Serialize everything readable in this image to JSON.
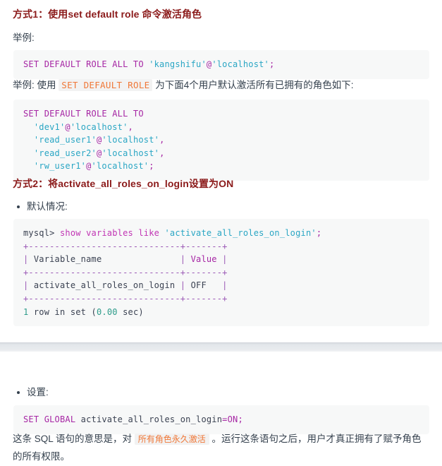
{
  "document": {
    "language": "zh-CN",
    "theme": {
      "heading_color": "#8b1a1a",
      "body_color": "#34404d",
      "code_bg": "#f7f8f8",
      "inline_code_color": "#f07838",
      "inline_code_bg": "#f2f2f2",
      "keyword_color": "#a626a4",
      "string_color": "#2aa6c4",
      "number_color": "#2d9c8a",
      "band_color": "#e4e7eb"
    }
  },
  "sections": [
    {
      "id": "method-1",
      "heading": {
        "prefix": "方式1：",
        "body": "使用set default role 命令激活角色",
        "full": "方式1：使用set default role 命令激活角色"
      },
      "label_example_1": "举例:",
      "code_block_1": {
        "lines": [
          [
            {
              "t": "SET DEFAULT ROLE ALL TO ",
              "c": "kw"
            },
            {
              "t": "'kangshifu'",
              "c": "str"
            },
            {
              "t": "@",
              "c": "punc"
            },
            {
              "t": "'localhost'",
              "c": "str"
            },
            {
              "t": ";",
              "c": "punc"
            }
          ]
        ]
      },
      "label_example_2": {
        "before": "举例: 使用 ",
        "code": "SET DEFAULT ROLE",
        "after": " 为下面4个用户默认激活所有已拥有的角色如下:"
      },
      "code_block_2": {
        "lines": [
          [
            {
              "t": "SET DEFAULT ROLE ALL TO",
              "c": "kw"
            }
          ],
          [
            {
              "t": "  ",
              "c": "plain"
            },
            {
              "t": "'dev1'",
              "c": "str"
            },
            {
              "t": "@",
              "c": "punc"
            },
            {
              "t": "'localhost'",
              "c": "str"
            },
            {
              "t": ",",
              "c": "punc"
            }
          ],
          [
            {
              "t": "  ",
              "c": "plain"
            },
            {
              "t": "'read_user1'",
              "c": "str"
            },
            {
              "t": "@",
              "c": "punc"
            },
            {
              "t": "'localhost'",
              "c": "str"
            },
            {
              "t": ",",
              "c": "punc"
            }
          ],
          [
            {
              "t": "  ",
              "c": "plain"
            },
            {
              "t": "'read_user2'",
              "c": "str"
            },
            {
              "t": "@",
              "c": "punc"
            },
            {
              "t": "'localhost'",
              "c": "str"
            },
            {
              "t": ",",
              "c": "punc"
            }
          ],
          [
            {
              "t": "  ",
              "c": "plain"
            },
            {
              "t": "'rw_user1'",
              "c": "str"
            },
            {
              "t": "@",
              "c": "punc"
            },
            {
              "t": "'localhost'",
              "c": "str"
            },
            {
              "t": ";",
              "c": "punc"
            }
          ]
        ]
      }
    },
    {
      "id": "method-2",
      "heading": {
        "prefix": "方式2：",
        "body": "将activate_all_roles_on_login设置为ON",
        "full": "方式2：将activate_all_roles_on_login设置为ON"
      },
      "bullet_default": "默认情况:",
      "code_block_mysql": {
        "lines": [
          [
            {
              "t": "mysql> ",
              "c": "prompt"
            },
            {
              "t": "show variables like ",
              "c": "kw2"
            },
            {
              "t": "'activate_all_roles_on_login'",
              "c": "str"
            },
            {
              "t": ";",
              "c": "punc"
            }
          ],
          [
            {
              "t": "+-----------------------------+-------+",
              "c": "sep"
            }
          ],
          [
            {
              "t": "| ",
              "c": "sep"
            },
            {
              "t": "Variable_name",
              "c": "plain"
            },
            {
              "t": "               | ",
              "c": "sep"
            },
            {
              "t": "Value",
              "c": "kw"
            },
            {
              "t": " |",
              "c": "sep"
            }
          ],
          [
            {
              "t": "+-----------------------------+-------+",
              "c": "sep"
            }
          ],
          [
            {
              "t": "| ",
              "c": "sep"
            },
            {
              "t": "activate_all_roles_on_login",
              "c": "plain"
            },
            {
              "t": " | ",
              "c": "sep"
            },
            {
              "t": "OFF",
              "c": "plain"
            },
            {
              "t": "   |",
              "c": "sep"
            }
          ],
          [
            {
              "t": "+-----------------------------+-------+",
              "c": "sep"
            }
          ],
          [
            {
              "t": "1",
              "c": "num"
            },
            {
              "t": " row in set (",
              "c": "plain"
            },
            {
              "t": "0.00",
              "c": "num"
            },
            {
              "t": " sec)",
              "c": "plain"
            }
          ]
        ]
      },
      "bullet_set": "设置:",
      "code_block_set": {
        "lines": [
          [
            {
              "t": "SET GLOBAL ",
              "c": "kw"
            },
            {
              "t": "activate_all_roles_on_login",
              "c": "plain"
            },
            {
              "t": "=",
              "c": "punc"
            },
            {
              "t": "ON",
              "c": "kw"
            },
            {
              "t": ";",
              "c": "punc"
            }
          ]
        ]
      },
      "closing_paragraph": {
        "before": "这条 SQL 语句的意思是，对 ",
        "highlight": "所有角色永久激活",
        "after": " 。运行这条语句之后，用户才真正拥有了赋予角色的所有权限。"
      }
    }
  ]
}
